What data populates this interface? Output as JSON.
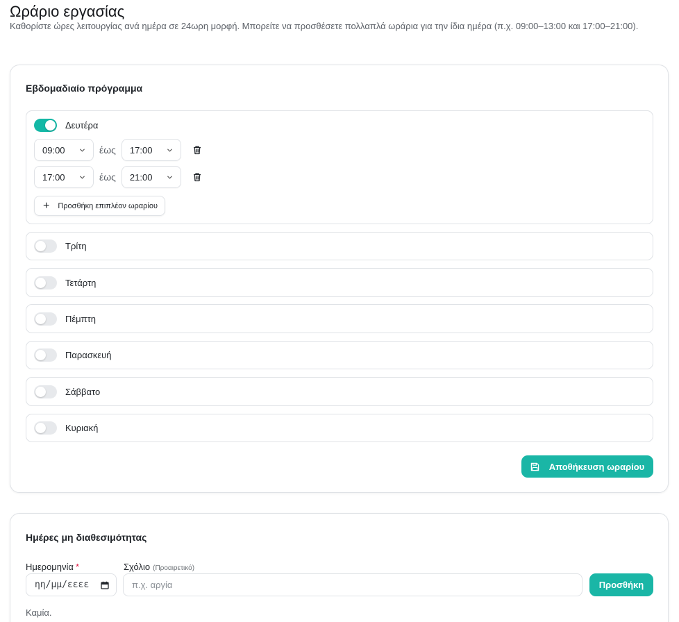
{
  "header": {
    "title": "Ωράριο εργασίας",
    "description": "Καθορίστε ώρες λειτουργίας ανά ημέρα σε 24ωρη μορφή. Μπορείτε να προσθέσετε πολλαπλά ωράρια για την ίδια ημέρα (π.χ. 09:00–13:00 και 17:00–21:00)."
  },
  "weekly": {
    "title": "Εβδομαδιαίο πρόγραμμα",
    "until_label": "έως",
    "add_slot_label": "Προσθήκη επιπλέον ωραρίου",
    "save_label": "Αποθήκευση ωραρίου",
    "days": [
      {
        "label": "Δευτέρα",
        "enabled": true,
        "slots": [
          {
            "from": "09:00",
            "to": "17:00"
          },
          {
            "from": "17:00",
            "to": "21:00"
          }
        ]
      },
      {
        "label": "Τρίτη",
        "enabled": false
      },
      {
        "label": "Τετάρτη",
        "enabled": false
      },
      {
        "label": "Πέμπτη",
        "enabled": false
      },
      {
        "label": "Παρασκευή",
        "enabled": false
      },
      {
        "label": "Σάββατο",
        "enabled": false
      },
      {
        "label": "Κυριακή",
        "enabled": false
      }
    ]
  },
  "unavailable": {
    "title": "Ημέρες μη διαθεσιμότητας",
    "date_label": "Ημερομηνία",
    "required_mark": "*",
    "date_placeholder": "ηη/μμ/εεεε",
    "comment_label": "Σχόλιο",
    "comment_optional": "(Προαιρετικό)",
    "comment_placeholder": "π.χ. αργία",
    "add_label": "Προσθήκη",
    "empty_text": "Καμία."
  },
  "colors": {
    "accent": "#1ab6a6",
    "toggle_off": "#e7e9ec",
    "border": "#dfe2e6"
  }
}
